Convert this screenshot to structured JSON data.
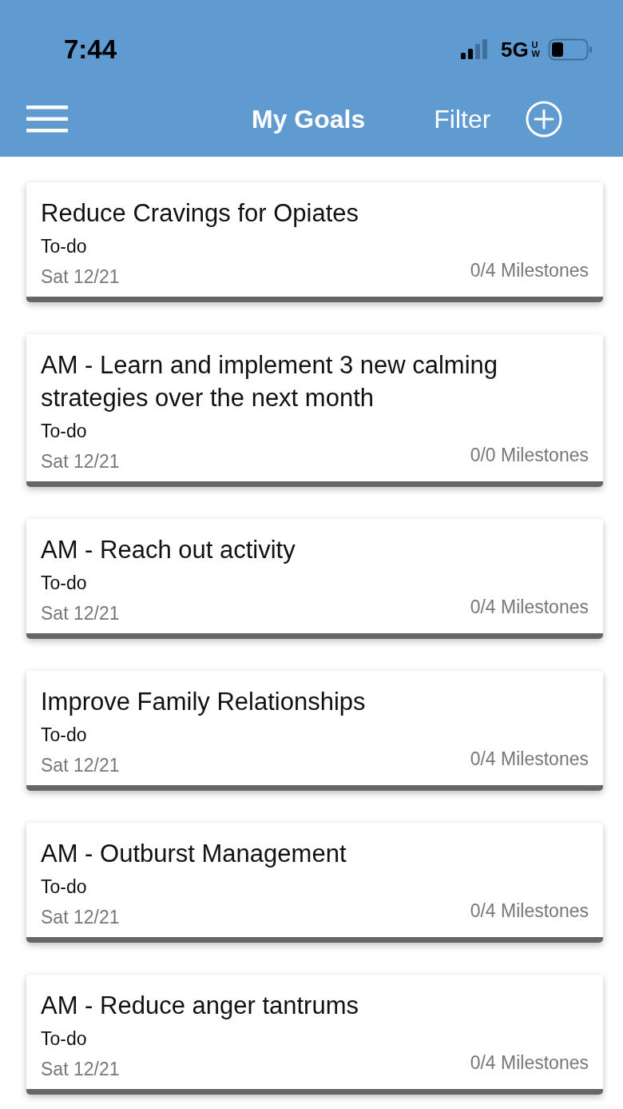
{
  "status_bar": {
    "time": "7:44",
    "network": "5G",
    "network_suffix_top": "U",
    "network_suffix_bottom": "W"
  },
  "nav_bar": {
    "title": "My Goals",
    "filter": "Filter"
  },
  "goals": [
    {
      "title": "Reduce Cravings for Opiates",
      "status": "To-do",
      "date": "Sat 12/21",
      "milestones": "0/4 Milestones"
    },
    {
      "title": "AM - Learn and implement 3 new calming strategies over the next month",
      "status": "To-do",
      "date": "Sat 12/21",
      "milestones": "0/0 Milestones"
    },
    {
      "title": "AM - Reach out activity",
      "status": "To-do",
      "date": "Sat 12/21",
      "milestones": "0/4 Milestones"
    },
    {
      "title": "Improve Family Relationships",
      "status": "To-do",
      "date": "Sat 12/21",
      "milestones": "0/4 Milestones"
    },
    {
      "title": "AM - Outburst Management",
      "status": "To-do",
      "date": "Sat 12/21",
      "milestones": "0/4 Milestones"
    },
    {
      "title": "AM - Reduce anger tantrums",
      "status": "To-do",
      "date": "Sat 12/21",
      "milestones": "0/4 Milestones"
    }
  ]
}
